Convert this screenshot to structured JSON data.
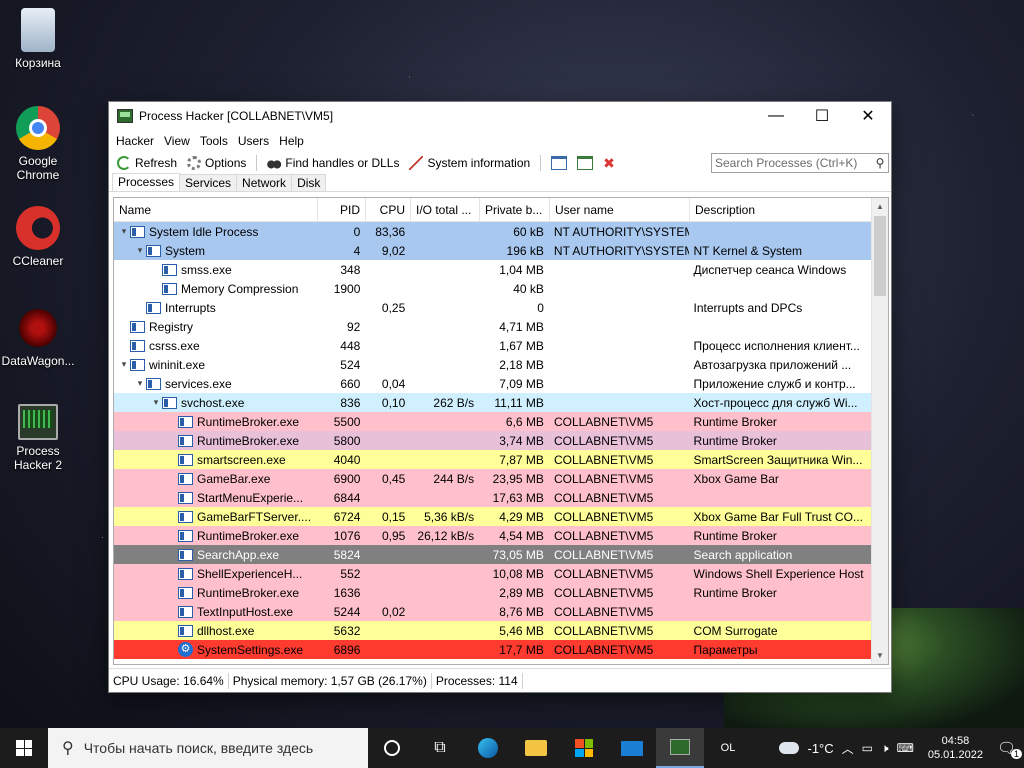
{
  "desktop": {
    "icons": [
      {
        "label": "Корзина"
      },
      {
        "label": "Google Chrome"
      },
      {
        "label": "CCleaner"
      },
      {
        "label": "DataWagon..."
      },
      {
        "label": "Process Hacker 2"
      }
    ]
  },
  "window": {
    "title": "Process Hacker [COLLABNET\\VM5]",
    "controls": {
      "minimize": "—",
      "maximize": "☐",
      "close": "✕"
    },
    "menu": [
      "Hacker",
      "View",
      "Tools",
      "Users",
      "Help"
    ],
    "toolbar": {
      "refresh": "Refresh",
      "options": "Options",
      "find_handles": "Find handles or DLLs",
      "system_info": "System information",
      "search_placeholder": "Search Processes (Ctrl+K)"
    },
    "tabs": [
      "Processes",
      "Services",
      "Network",
      "Disk"
    ],
    "active_tab": "Processes",
    "columns": [
      "Name",
      "PID",
      "CPU",
      "I/O total ...",
      "Private b...",
      "User name",
      "Description"
    ],
    "rows": [
      {
        "name": "System Idle Process",
        "pid": "0",
        "cpu": "83,36",
        "io": "",
        "priv": "60 kB",
        "user": "NT AUTHORITY\\SYSTEM",
        "desc": "",
        "depth": 0,
        "toggle": "▾",
        "color": "#a8c8f0"
      },
      {
        "name": "System",
        "pid": "4",
        "cpu": "9,02",
        "io": "",
        "priv": "196 kB",
        "user": "NT AUTHORITY\\SYSTEM",
        "desc": "NT Kernel & System",
        "depth": 1,
        "toggle": "▾",
        "color": "#a8c8f0"
      },
      {
        "name": "smss.exe",
        "pid": "348",
        "cpu": "",
        "io": "",
        "priv": "1,04 MB",
        "user": "",
        "desc": "Диспетчер сеанса  Windows",
        "depth": 2,
        "toggle": "",
        "color": "#ffffff"
      },
      {
        "name": "Memory Compression",
        "pid": "1900",
        "cpu": "",
        "io": "",
        "priv": "40 kB",
        "user": "",
        "desc": "",
        "depth": 2,
        "toggle": "",
        "color": "#ffffff"
      },
      {
        "name": "Interrupts",
        "pid": "",
        "cpu": "0,25",
        "io": "",
        "priv": "0",
        "user": "",
        "desc": "Interrupts and DPCs",
        "depth": 1,
        "toggle": "",
        "color": "#ffffff"
      },
      {
        "name": "Registry",
        "pid": "92",
        "cpu": "",
        "io": "",
        "priv": "4,71 MB",
        "user": "",
        "desc": "",
        "depth": 0,
        "toggle": "",
        "color": "#ffffff"
      },
      {
        "name": "csrss.exe",
        "pid": "448",
        "cpu": "",
        "io": "",
        "priv": "1,67 MB",
        "user": "",
        "desc": "Процесс исполнения клиент...",
        "depth": 0,
        "toggle": "",
        "color": "#ffffff"
      },
      {
        "name": "wininit.exe",
        "pid": "524",
        "cpu": "",
        "io": "",
        "priv": "2,18 MB",
        "user": "",
        "desc": "Автозагрузка приложений ...",
        "depth": 0,
        "toggle": "▾",
        "color": "#ffffff"
      },
      {
        "name": "services.exe",
        "pid": "660",
        "cpu": "0,04",
        "io": "",
        "priv": "7,09 MB",
        "user": "",
        "desc": "Приложение служб и контр...",
        "depth": 1,
        "toggle": "▾",
        "color": "#ffffff"
      },
      {
        "name": "svchost.exe",
        "pid": "836",
        "cpu": "0,10",
        "io": "262 B/s",
        "priv": "11,11 MB",
        "user": "",
        "desc": "Хост-процесс для служб Wi...",
        "depth": 2,
        "toggle": "▾",
        "color": "#d0f0ff"
      },
      {
        "name": "RuntimeBroker.exe",
        "pid": "5500",
        "cpu": "",
        "io": "",
        "priv": "6,6 MB",
        "user": "COLLABNET\\VM5",
        "desc": "Runtime Broker",
        "depth": 3,
        "toggle": "",
        "color": "#ffc0cb"
      },
      {
        "name": "RuntimeBroker.exe",
        "pid": "5800",
        "cpu": "",
        "io": "",
        "priv": "3,74 MB",
        "user": "COLLABNET\\VM5",
        "desc": "Runtime Broker",
        "depth": 3,
        "toggle": "",
        "color": "#e8c0d8"
      },
      {
        "name": "smartscreen.exe",
        "pid": "4040",
        "cpu": "",
        "io": "",
        "priv": "7,87 MB",
        "user": "COLLABNET\\VM5",
        "desc": "SmartScreen Защитника Win...",
        "depth": 3,
        "toggle": "",
        "color": "#ffff99"
      },
      {
        "name": "GameBar.exe",
        "pid": "6900",
        "cpu": "0,45",
        "io": "244 B/s",
        "priv": "23,95 MB",
        "user": "COLLABNET\\VM5",
        "desc": "Xbox Game Bar",
        "depth": 3,
        "toggle": "",
        "color": "#ffc0cb"
      },
      {
        "name": "StartMenuExperie...",
        "pid": "6844",
        "cpu": "",
        "io": "",
        "priv": "17,63 MB",
        "user": "COLLABNET\\VM5",
        "desc": "",
        "depth": 3,
        "toggle": "",
        "color": "#ffc0cb"
      },
      {
        "name": "GameBarFTServer....",
        "pid": "6724",
        "cpu": "0,15",
        "io": "5,36 kB/s",
        "priv": "4,29 MB",
        "user": "COLLABNET\\VM5",
        "desc": "Xbox Game Bar Full Trust CO...",
        "depth": 3,
        "toggle": "",
        "color": "#ffff99"
      },
      {
        "name": "RuntimeBroker.exe",
        "pid": "1076",
        "cpu": "0,95",
        "io": "26,12 kB/s",
        "priv": "4,54 MB",
        "user": "COLLABNET\\VM5",
        "desc": "Runtime Broker",
        "depth": 3,
        "toggle": "",
        "color": "#ffc0cb"
      },
      {
        "name": "SearchApp.exe",
        "pid": "5824",
        "cpu": "",
        "io": "",
        "priv": "73,05 MB",
        "user": "COLLABNET\\VM5",
        "desc": "Search application",
        "depth": 3,
        "toggle": "",
        "color": "#808080"
      },
      {
        "name": "ShellExperienceH...",
        "pid": "552",
        "cpu": "",
        "io": "",
        "priv": "10,08 MB",
        "user": "COLLABNET\\VM5",
        "desc": "Windows Shell Experience Host",
        "depth": 3,
        "toggle": "",
        "color": "#ffc0cb"
      },
      {
        "name": "RuntimeBroker.exe",
        "pid": "1636",
        "cpu": "",
        "io": "",
        "priv": "2,89 MB",
        "user": "COLLABNET\\VM5",
        "desc": "Runtime Broker",
        "depth": 3,
        "toggle": "",
        "color": "#ffc0cb"
      },
      {
        "name": "TextInputHost.exe",
        "pid": "5244",
        "cpu": "0,02",
        "io": "",
        "priv": "8,76 MB",
        "user": "COLLABNET\\VM5",
        "desc": "",
        "depth": 3,
        "toggle": "",
        "color": "#ffc0cb"
      },
      {
        "name": "dllhost.exe",
        "pid": "5632",
        "cpu": "",
        "io": "",
        "priv": "5,46 MB",
        "user": "COLLABNET\\VM5",
        "desc": "COM Surrogate",
        "depth": 3,
        "toggle": "",
        "color": "#ffff99"
      },
      {
        "name": "SystemSettings.exe",
        "pid": "6896",
        "cpu": "",
        "io": "",
        "priv": "17,7 MB",
        "user": "COLLABNET\\VM5",
        "desc": "Параметры",
        "depth": 3,
        "toggle": "",
        "color": "#ff3b30",
        "icon": "gear"
      }
    ],
    "status": {
      "cpu": "CPU Usage: 16.64%",
      "memory": "Physical memory: 1,57 GB (26.17%)",
      "processes": "Processes: 114"
    }
  },
  "taskbar": {
    "search_placeholder": "Чтобы начать поиск, введите здесь",
    "lang": "OL",
    "weather": "-1°C",
    "time": "04:58",
    "date": "05.01.2022",
    "notifications": "1"
  }
}
